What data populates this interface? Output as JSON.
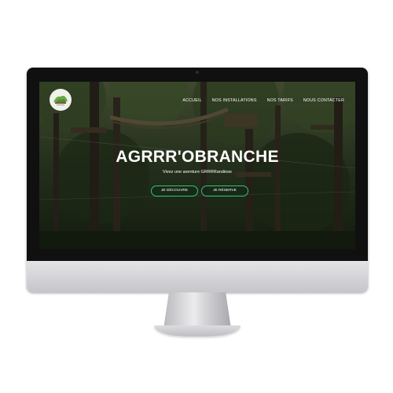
{
  "site": {
    "logo_icon": "adventure-park-logo-icon",
    "nav": {
      "items": [
        {
          "label": "ACCUEIL"
        },
        {
          "label": "NOS INSTALLATIONS"
        },
        {
          "label": "NOS TARIFS"
        },
        {
          "label": "NOUS CONTACTER"
        }
      ]
    },
    "hero": {
      "title": "AGRRR'OBRANCHE",
      "subtitle": "Vivez une aventure GRRRRandiose",
      "buttons": {
        "discover_label": "JE DÉCOUVRE",
        "book_label": "JE RÉSERVE"
      }
    }
  },
  "colors": {
    "button_border": "#35c27a",
    "overlay": "rgba(0,0,0,0.42)",
    "monitor_frame": "#101010",
    "monitor_body": "#d8d8dc"
  }
}
